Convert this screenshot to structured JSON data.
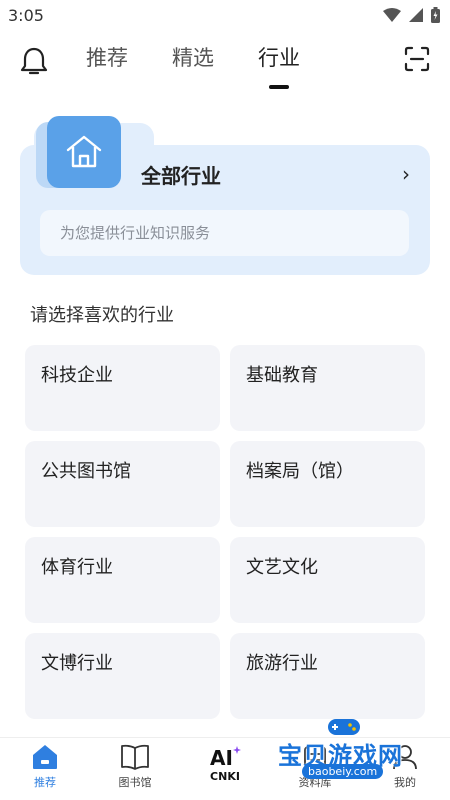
{
  "status": {
    "time": "3:05"
  },
  "nav": {
    "tabs": [
      {
        "label": "推荐",
        "active": false
      },
      {
        "label": "精选",
        "active": false
      },
      {
        "label": "行业",
        "active": true
      }
    ]
  },
  "hero": {
    "title": "全部行业",
    "arrow": "›",
    "subtitle": "为您提供行业知识服务"
  },
  "section": {
    "title": "请选择喜欢的行业"
  },
  "industries": [
    "科技企业",
    "基础教育",
    "公共图书馆",
    "档案局（馆）",
    "体育行业",
    "文艺文化",
    "文博行业",
    "旅游行业"
  ],
  "bottom_nav": [
    {
      "label": "推荐",
      "icon": "home-icon",
      "active": true
    },
    {
      "label": "图书馆",
      "icon": "book-icon",
      "active": false
    },
    {
      "label": "CNKI",
      "icon": "ai-icon",
      "active": false
    },
    {
      "label": "资料库",
      "icon": "database-icon",
      "active": false
    },
    {
      "label": "我的",
      "icon": "user-icon",
      "active": false
    }
  ],
  "watermark": {
    "text": "宝贝游戏网",
    "url": "baobeiy.com"
  },
  "colors": {
    "accent": "#2f7fe0",
    "hero_bg": "#e2eefc",
    "card_bg": "#f3f4f8",
    "icon_bg": "#5aa1e8"
  }
}
